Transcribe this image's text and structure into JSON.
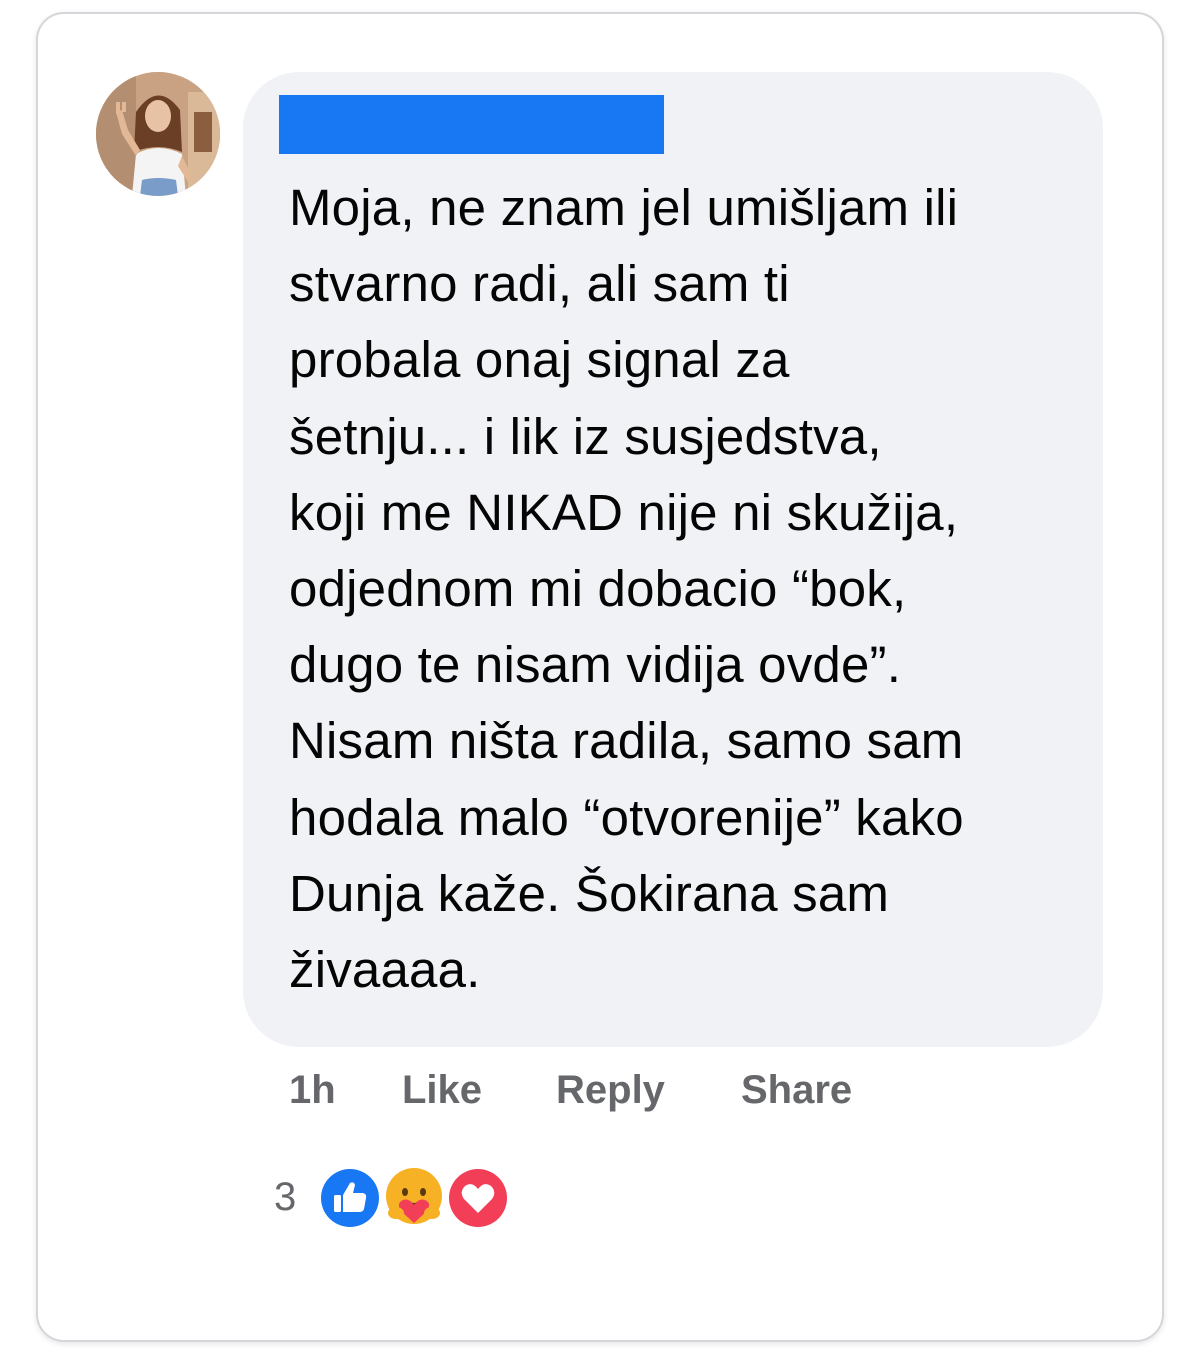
{
  "comment": {
    "author_name_redacted": true,
    "text": "Moja, ne znam jel umišljam ili\nstvarno radi, ali sam ti\nprobala onaj signal za\nšetnju... i lik iz susjedstva,\nkoji me NIKAD nije ni skužija,\nodjednom mi dobacio “bok,\ndugo te nisam vidija ovde”.\nNisam ništa radila, samo sam\nhodala malo “otvorenije” kako\nDunja kaže. Šokirana sam\nživaaaa."
  },
  "actions": {
    "time": "1h",
    "like": "Like",
    "reply": "Reply",
    "share": "Share"
  },
  "reactions": {
    "count": "3",
    "icons": [
      "like-icon",
      "care-icon",
      "love-icon"
    ]
  },
  "colors": {
    "name_redaction": "#1877f2",
    "bubble": "#f0f2f5",
    "text": "#050505",
    "muted": "#65676b",
    "like": "#1877f2",
    "love": "#f33e58",
    "care": "#f7b125"
  }
}
